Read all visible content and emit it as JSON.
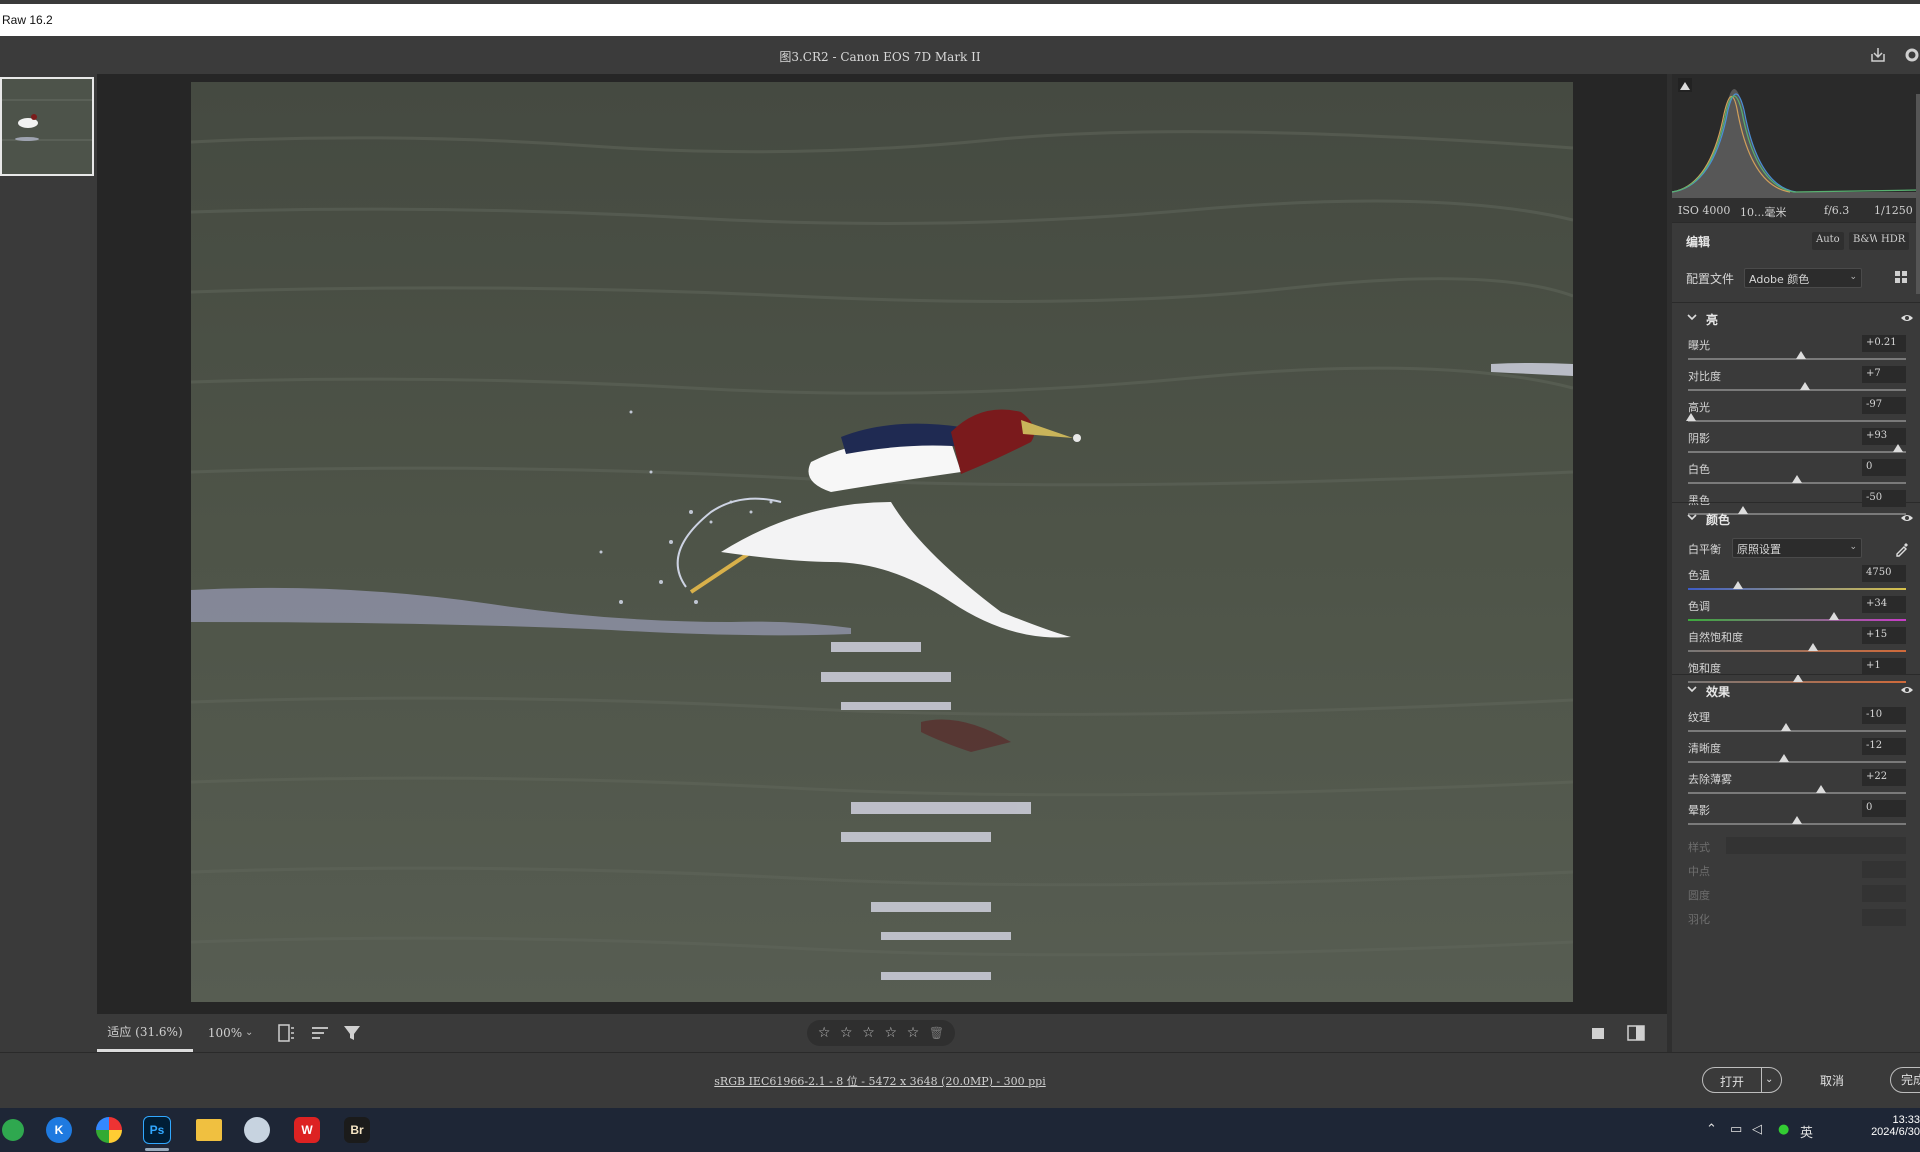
{
  "window": {
    "title": "Raw 16.2"
  },
  "header": {
    "filename": "图3.CR2 -  Canon EOS 7D Mark II"
  },
  "exif": {
    "iso": "ISO 4000",
    "focal": "10...毫米",
    "aperture": "f/6.3",
    "shutter": "1/1250"
  },
  "edit": {
    "label": "编辑",
    "auto": "Auto",
    "bw": "B&W",
    "hdr": "HDR"
  },
  "profile": {
    "label": "配置文件",
    "value": "Adobe 颜色"
  },
  "light": {
    "title": "亮",
    "sliders": [
      {
        "label": "曝光",
        "value": "+0.21",
        "pos": 0.52
      },
      {
        "label": "对比度",
        "value": "+7",
        "pos": 0.535
      },
      {
        "label": "高光",
        "value": "-97",
        "pos": 0.015
      },
      {
        "label": "阴影",
        "value": "+93",
        "pos": 0.965
      },
      {
        "label": "白色",
        "value": "0",
        "pos": 0.5
      },
      {
        "label": "黑色",
        "value": "-50",
        "pos": 0.25
      }
    ]
  },
  "color": {
    "title": "颜色",
    "wb_label": "白平衡",
    "wb_value": "原照设置",
    "sliders": [
      {
        "label": "色温",
        "value": "4750",
        "pos": 0.23
      },
      {
        "label": "色调",
        "value": "+34",
        "pos": 0.67
      },
      {
        "label": "自然饱和度",
        "value": "+15",
        "pos": 0.575
      },
      {
        "label": "饱和度",
        "value": "+1",
        "pos": 0.505
      }
    ]
  },
  "effects": {
    "title": "效果",
    "sliders": [
      {
        "label": "纹理",
        "value": "-10",
        "pos": 0.45
      },
      {
        "label": "清晰度",
        "value": "-12",
        "pos": 0.44
      },
      {
        "label": "去除薄雾",
        "value": "+22",
        "pos": 0.61
      },
      {
        "label": "晕影",
        "value": "0",
        "pos": 0.5
      }
    ],
    "disabled": [
      {
        "label": "样式"
      },
      {
        "label": "中点"
      },
      {
        "label": "圆度"
      },
      {
        "label": "羽化"
      }
    ]
  },
  "toolbar": {
    "zoom_fit": "适应 (31.6%)",
    "zoom_100": "100%"
  },
  "footer": {
    "info": "sRGB IEC61966-2.1 - 8 位 - 5472 x 3648 (20.0MP) - 300 ppi",
    "open": "打开",
    "cancel": "取消",
    "done": "完成"
  },
  "taskbar": {
    "apps": [
      "Ps",
      "Br"
    ],
    "ime": "英",
    "time": "13:33",
    "date": "2024/6/30"
  },
  "colors": {
    "accent": "#0a63c9",
    "panel": "#3a3a3a",
    "bg": "#262626"
  }
}
